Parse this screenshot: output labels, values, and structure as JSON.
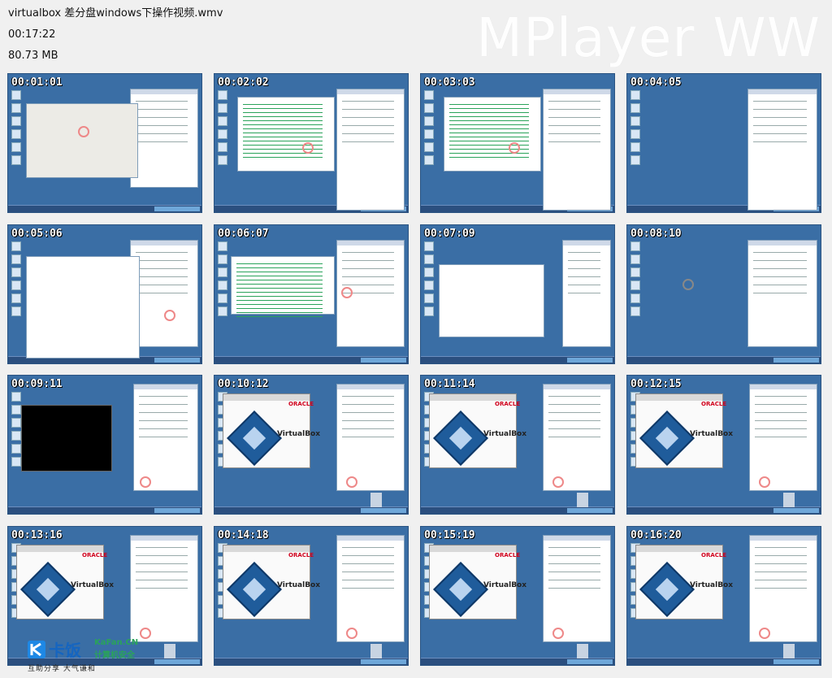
{
  "header": {
    "file_name": "virtualbox 差分盘windows下操作视频.wmv",
    "duration": "00:17:22",
    "file_size": "80.73 MB"
  },
  "brand": "MPlayer WW",
  "thumbnails": [
    {
      "time": "00:01:01"
    },
    {
      "time": "00:02:02"
    },
    {
      "time": "00:03:03"
    },
    {
      "time": "00:04:05"
    },
    {
      "time": "00:05:06"
    },
    {
      "time": "00:06:07"
    },
    {
      "time": "00:07:09"
    },
    {
      "time": "00:08:10"
    },
    {
      "time": "00:09:11"
    },
    {
      "time": "00:10:12"
    },
    {
      "time": "00:11:14"
    },
    {
      "time": "00:12:15"
    },
    {
      "time": "00:13:16"
    },
    {
      "time": "00:14:18"
    },
    {
      "time": "00:15:19"
    },
    {
      "time": "00:16:20"
    }
  ],
  "vbox": {
    "oracle": "ORACLE",
    "name": "VirtualBox"
  },
  "watermark": {
    "brand": "卡饭",
    "site": "KaFan.CN",
    "tagline": "计算机安全",
    "slogan": "互助分享   大气谦和"
  },
  "colors": {
    "desktop": "#3a6ea5",
    "accent_red": "#d0001c"
  }
}
